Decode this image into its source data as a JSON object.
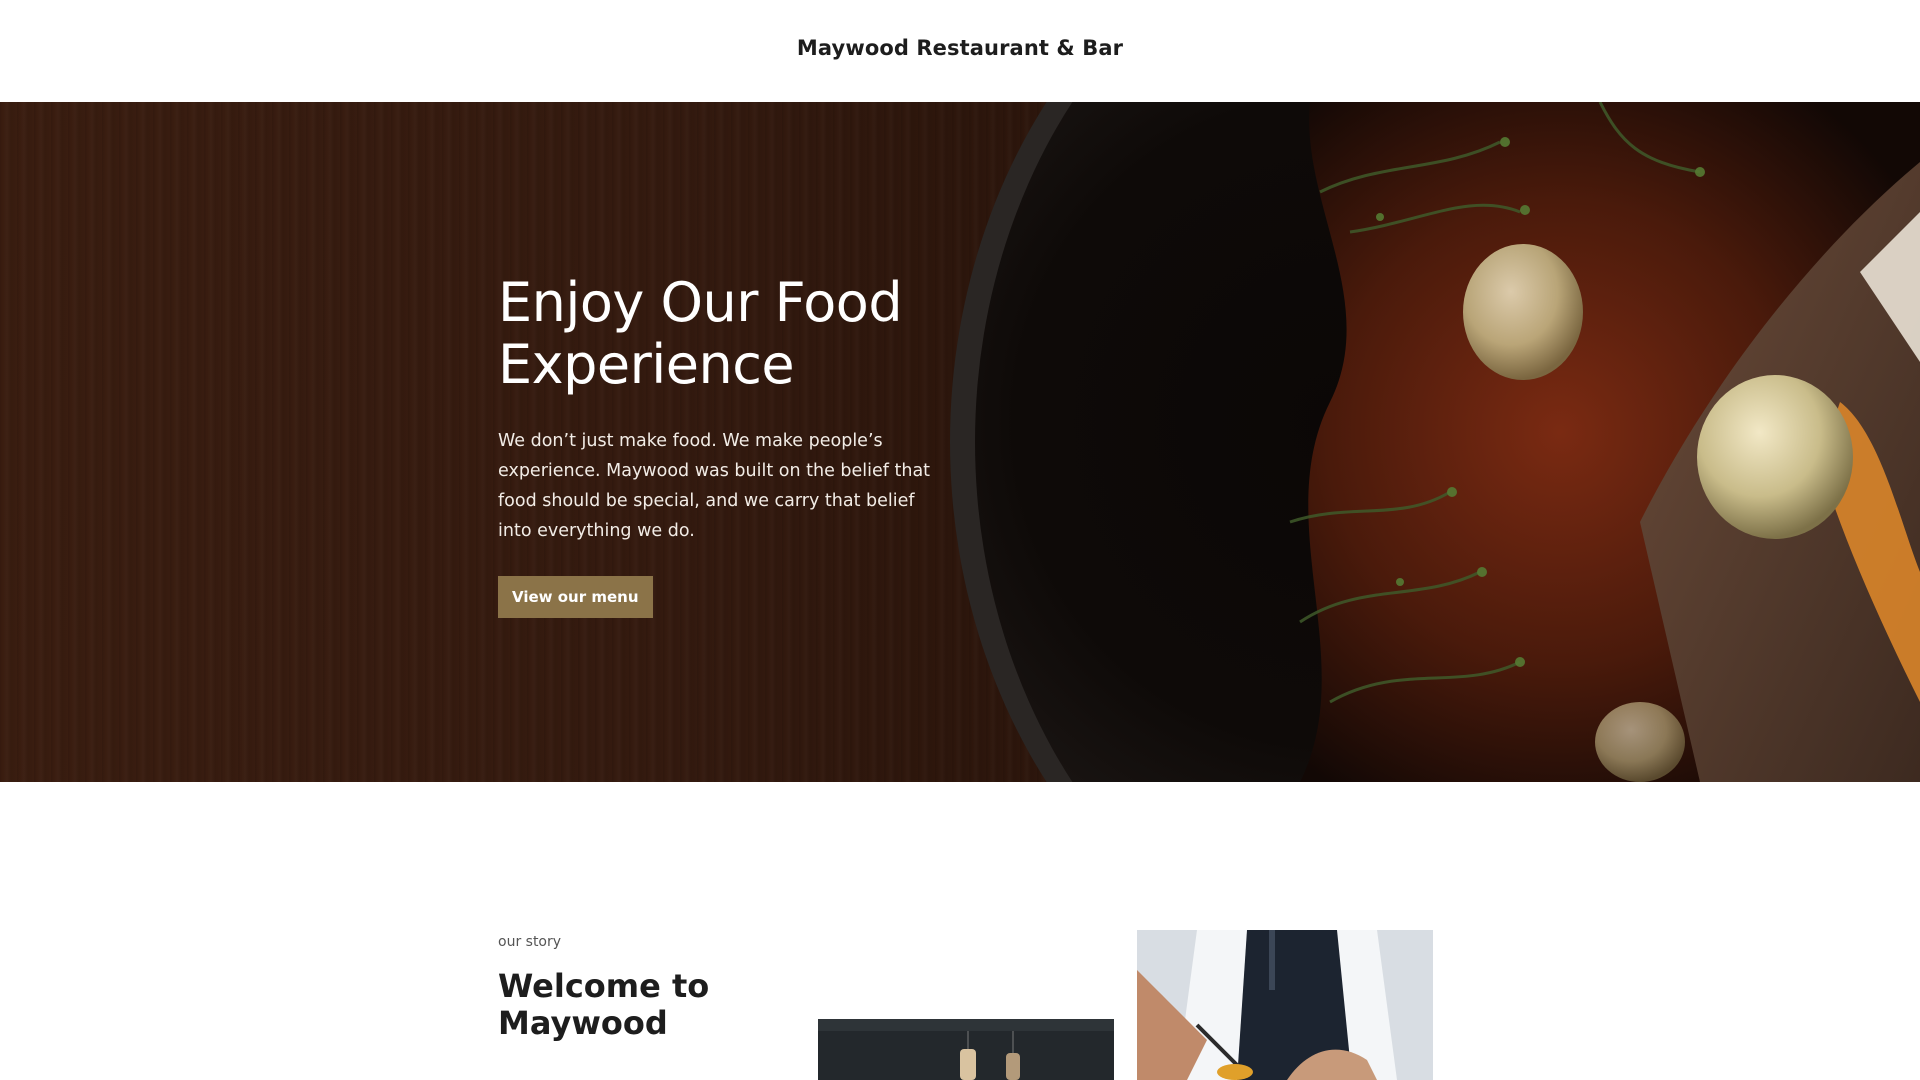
{
  "header": {
    "site_title": "Maywood Restaurant & Bar"
  },
  "hero": {
    "heading_line1": "Enjoy Our Food",
    "heading_line2": "Experience",
    "text": "We don’t just make food. We make people’s experience. Maywood was built on the belief that food should be special, and we carry that belief into everything we do.",
    "button_label": "View our menu",
    "button_color": "#8b7348"
  },
  "story": {
    "eyebrow": "our story",
    "heading": "Welcome to Maywood"
  },
  "colors": {
    "hero_wood": "#2f180d",
    "accent": "#8b7348",
    "text_dark": "#1d1d1d"
  }
}
